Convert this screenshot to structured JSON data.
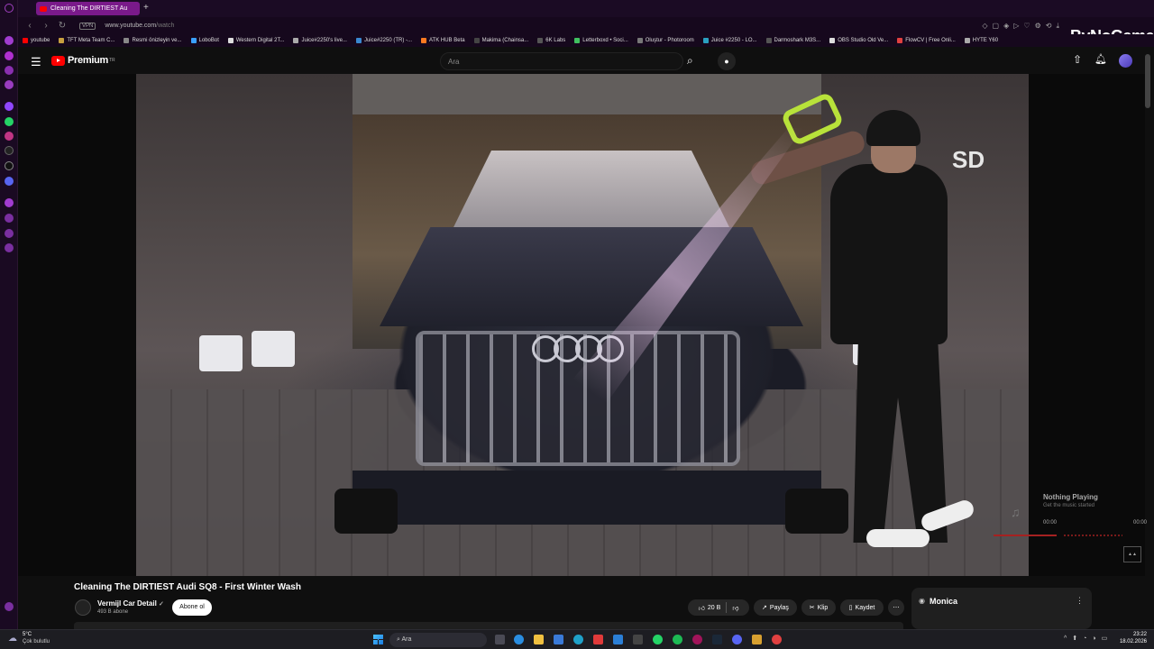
{
  "browser": {
    "tab_title": "Cleaning The DIRTIEST Au",
    "new_tab": "+",
    "vpn": "VPN",
    "url_host": "www.youtube.com",
    "url_path": "/watch",
    "watermark": "ByNoGame",
    "bookmarks": [
      {
        "label": "youtube",
        "color": "#ff0000"
      },
      {
        "label": "TFT Meta Team C...",
        "color": "#c8a040"
      },
      {
        "label": "Resmi önizleyin ve...",
        "color": "#888888"
      },
      {
        "label": "LoboBot",
        "color": "#3aa0ff"
      },
      {
        "label": "Western Digital 2T...",
        "color": "#dddddd"
      },
      {
        "label": "Juice#2250's live...",
        "color": "#aaaaaa"
      },
      {
        "label": "Juice#2250 (TR) -...",
        "color": "#3a88d0"
      },
      {
        "label": "ATK HUB Beta",
        "color": "#ff7a20"
      },
      {
        "label": "Makima (Chainsa...",
        "color": "#444444"
      },
      {
        "label": "6K Labs",
        "color": "#555555"
      },
      {
        "label": "Letterboxd • Soci...",
        "color": "#40c060"
      },
      {
        "label": "Oluştur - Photoroom",
        "color": "#777777"
      },
      {
        "label": "Juice #2250 - LO...",
        "color": "#2aa0c0"
      },
      {
        "label": "Darmoshark M3S...",
        "color": "#555555"
      },
      {
        "label": "OBS Studio Old Ve...",
        "color": "#dddddd"
      },
      {
        "label": "FlowCV | Free Onli...",
        "color": "#e04040"
      },
      {
        "label": "HYTE Y60",
        "color": "#aaaaaa"
      }
    ]
  },
  "youtube": {
    "logo_text": "Premium",
    "logo_region": "TR",
    "search_placeholder": "Ara",
    "video_title": "Cleaning The DIRTIEST Audi SQ8 - First Winter Wash",
    "channel_name": "Vermijl Car Detail",
    "channel_subs": "493 B abone",
    "subscribe_label": "Abone ol",
    "like_count": "20 B",
    "share_label": "Paylaş",
    "clip_label": "Klip",
    "save_label": "Kaydet",
    "video_sign": "SD"
  },
  "music_widget": {
    "title": "Nothing Playing",
    "subtitle": "Get the music started",
    "time_start": "00:00",
    "time_end": "00:00"
  },
  "monica": {
    "label": "Monica"
  },
  "taskbar": {
    "temp": "5°C",
    "weather": "Çok bulutlu",
    "search": "Ara",
    "time": "23:22",
    "date": "18.02.2026"
  },
  "colors": {
    "accent_tab": "#7a1a8a",
    "youtube_red": "#ff0000"
  }
}
